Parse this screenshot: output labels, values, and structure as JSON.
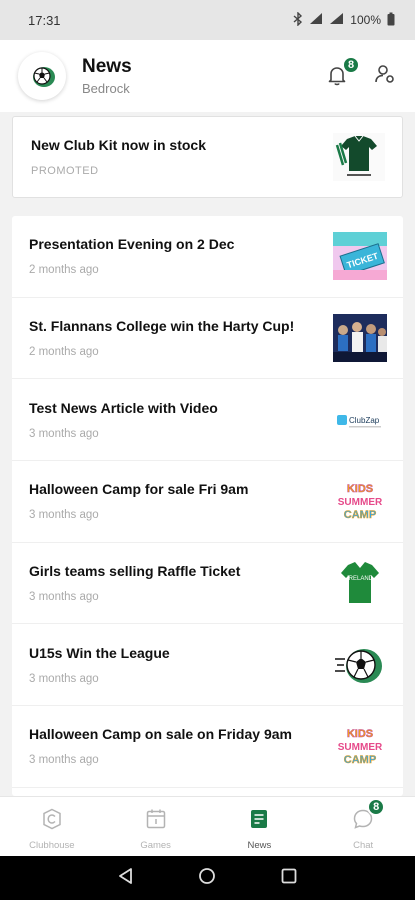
{
  "status_bar": {
    "time": "17:31",
    "battery": "100%"
  },
  "header": {
    "title": "News",
    "subtitle": "Bedrock",
    "notification_count": "8"
  },
  "promo": {
    "title": "New Club Kit now in stock",
    "tag": "PROMOTED"
  },
  "news": [
    {
      "title": "Presentation Evening on 2 Dec",
      "time": "2 months ago",
      "thumb": "ticket-image"
    },
    {
      "title": "St. Flannans College win the Harty Cup!",
      "time": "2 months ago",
      "thumb": "team-photo-image"
    },
    {
      "title": "Test News Article with Video",
      "time": "3 months ago",
      "thumb": "clubzap-logo-image",
      "thumb_text": "ClubZap"
    },
    {
      "title": "Halloween Camp for sale Fri 9am",
      "time": "3 months ago",
      "thumb": "kids-camp-image",
      "thumb_text": [
        "KIDS",
        "SUMMER",
        "CAMP"
      ]
    },
    {
      "title": "Girls teams selling Raffle Ticket",
      "time": "3 months ago",
      "thumb": "green-jersey-image",
      "thumb_text": "IRELAND"
    },
    {
      "title": "U15s Win the League",
      "time": "3 months ago",
      "thumb": "football-image"
    },
    {
      "title": "Halloween Camp on sale on Friday 9am",
      "time": "3 months ago",
      "thumb": "kids-camp-image",
      "thumb_text": [
        "KIDS",
        "SUMMER",
        "CAMP"
      ]
    }
  ],
  "bottom_nav": {
    "items": [
      {
        "label": "Clubhouse",
        "icon": "clubhouse-icon"
      },
      {
        "label": "Games",
        "icon": "calendar-icon"
      },
      {
        "label": "News",
        "icon": "news-icon",
        "active": true
      },
      {
        "label": "Chat",
        "icon": "chat-icon",
        "badge": "8"
      }
    ]
  },
  "colors": {
    "accent": "#1a7a47",
    "muted": "#aaaaaa",
    "background": "#f2f2f2"
  }
}
